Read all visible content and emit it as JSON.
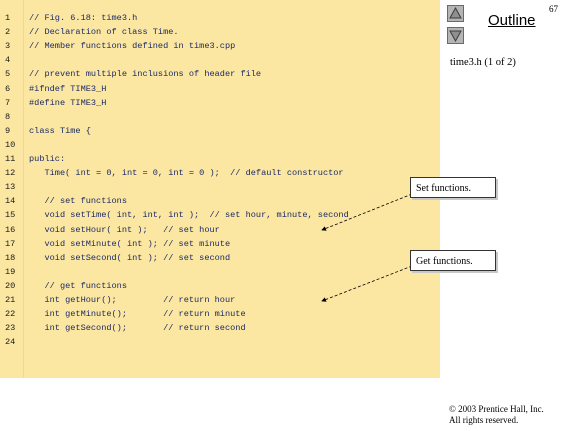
{
  "code": {
    "lines": [
      {
        "num": "1",
        "text": "// Fig. 6.18: time3.h"
      },
      {
        "num": "2",
        "text": "// Declaration of class Time."
      },
      {
        "num": "3",
        "text": "// Member functions defined in time3.cpp"
      },
      {
        "num": "4",
        "text": ""
      },
      {
        "num": "5",
        "text": "// prevent multiple inclusions of header file"
      },
      {
        "num": "6",
        "text": "#ifndef TIME3_H"
      },
      {
        "num": "7",
        "text": "#define TIME3_H"
      },
      {
        "num": "8",
        "text": ""
      },
      {
        "num": "9",
        "text": "class Time {"
      },
      {
        "num": "10",
        "text": ""
      },
      {
        "num": "11",
        "text": "public:"
      },
      {
        "num": "12",
        "text": "   Time( int = 0, int = 0, int = 0 );  // default constructor"
      },
      {
        "num": "13",
        "text": ""
      },
      {
        "num": "14",
        "text": "   // set functions"
      },
      {
        "num": "15",
        "text": "   void setTime( int, int, int );  // set hour, minute, second"
      },
      {
        "num": "16",
        "text": "   void setHour( int );   // set hour"
      },
      {
        "num": "17",
        "text": "   void setMinute( int ); // set minute"
      },
      {
        "num": "18",
        "text": "   void setSecond( int ); // set second"
      },
      {
        "num": "19",
        "text": ""
      },
      {
        "num": "20",
        "text": "   // get functions"
      },
      {
        "num": "21",
        "text": "   int getHour();         // return hour"
      },
      {
        "num": "22",
        "text": "   int getMinute();       // return minute"
      },
      {
        "num": "23",
        "text": "   int getSecond();       // return second"
      },
      {
        "num": "24",
        "text": ""
      }
    ]
  },
  "sidebar": {
    "page_number": "67",
    "outline_label": "Outline",
    "file_label": "time3.h (1 of 2)",
    "nav_up_icon": "triangle-up-icon",
    "nav_down_icon": "triangle-down-icon"
  },
  "callouts": {
    "set_functions": "Set functions.",
    "get_functions": "Get functions."
  },
  "footer": {
    "copyright_line1": "© 2003 Prentice Hall, Inc.",
    "copyright_line2": "All rights reserved."
  },
  "colors": {
    "code_background": "#fbe7a1",
    "code_text": "#1c2a66",
    "nav_button": "#b5b5b5"
  }
}
